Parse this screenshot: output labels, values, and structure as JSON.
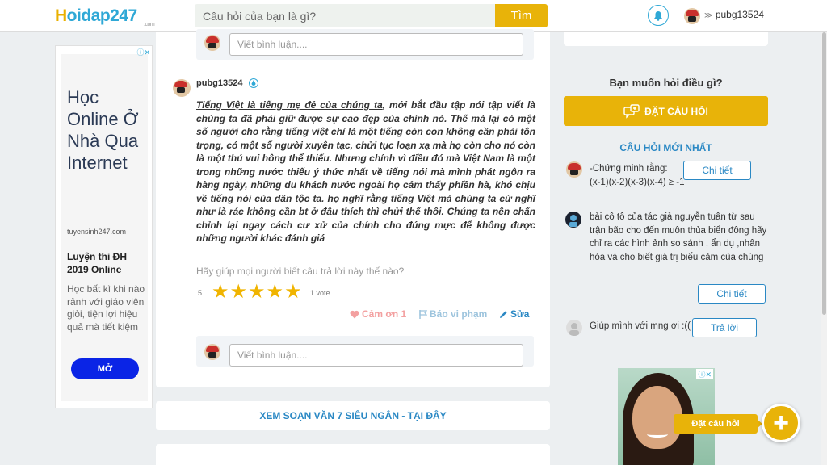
{
  "header": {
    "logo_h": "H",
    "logo_text": "oidap247",
    "logo_com": ".com",
    "search_placeholder": "Câu hỏi của bạn là gì?",
    "search_button": "Tìm",
    "username": "pubg13524"
  },
  "left_ad": {
    "title": "Học Online Ở Nhà Qua Internet",
    "domain": "tuyensinh247.com",
    "subtitle": "Luyện thi ĐH 2019 Online",
    "description": "Học bất kì khi nào rảnh với giáo viên giỏi, tiện lợi hiệu quả mà tiết kiệm",
    "button": "MỞ"
  },
  "answer": {
    "comment_placeholder": "Viết bình luận....",
    "username": "pubg13524",
    "body_underlined": "Tiếng Việt là tiếng mẹ đẻ của chúng ta",
    "body_rest": ", mới bắt đầu tập nói tập viết là chúng ta đã phải giữ được sự cao đẹp của chính nó. Thế mà lại có một số người cho rằng tiếng việt chỉ là một tiếng cỏn con không cần phải tôn trọng, có một số người xuyên tạc, chửi tục loạn xạ mà họ còn cho nó còn là một thú vui hông thể thiếu. Nhưng chính vì điều đó mà Việt Nam là một trong những nước thiếu ý thức nhất về tiếng nói mà mình phát ngôn ra hàng ngày,  những du khách nước ngoài họ cảm thấy phiền hà, khó chịu về tiếng nói của dân tộc ta. họ nghĩ rằng tiếng Việt mà chúng ta cứ nghĩ như là rác không cần bt ở đâu thích thì chửi thế thôi. Chúng ta nên chấn chỉnh lại ngay cách cư xử của chính cho đúng mực để không được những người khác đánh giá",
    "help_text": "Hãy giúp mọi người biết câu trả lời này thế nào?",
    "rating": "5",
    "star_count": 5,
    "votes": "1 vote",
    "thanks": "Cảm ơn 1",
    "report": "Báo vi phạm",
    "edit": "Sửa"
  },
  "banner": {
    "text": "XEM SOẠN VĂN 7 SIÊU NGẮN - TẠI ĐÂY"
  },
  "sidebar": {
    "ask_title": "Bạn muốn hỏi điều gì?",
    "ask_button": "ĐẶT CÂU HỎI",
    "latest_title": "CÂU HỎI MỚI NHẤT",
    "questions": [
      {
        "line1": "-Chứng minh rằng:",
        "line2": "(x-1)(x-2)(x-3)(x-4)  ≥ -1",
        "button": "Chi tiết"
      },
      {
        "text": "bài cô tô của tác giả nguyễn tuân từ sau trận bão cho đến muôn thủa biển đông hãy chỉ ra các hình ảnh so sánh , ẩn dụ ,nhân hóa và cho biết giá trị biểu cảm của chúng",
        "button": "Chi tiết"
      },
      {
        "text": "Giúp mình với mng ơi :((",
        "button": "Trả lời"
      }
    ]
  },
  "fab": {
    "label": "Đặt câu hỏi",
    "symbol": "+"
  },
  "icons": {
    "search": "search-icon",
    "bell": "bell-icon",
    "heart": "heart-icon",
    "flag": "flag-icon",
    "pencil": "pencil-icon",
    "ask": "question-bubble-icon"
  },
  "colors": {
    "accent": "#e8b309",
    "link": "#2a88c4",
    "logo": "#2fa8d6"
  }
}
